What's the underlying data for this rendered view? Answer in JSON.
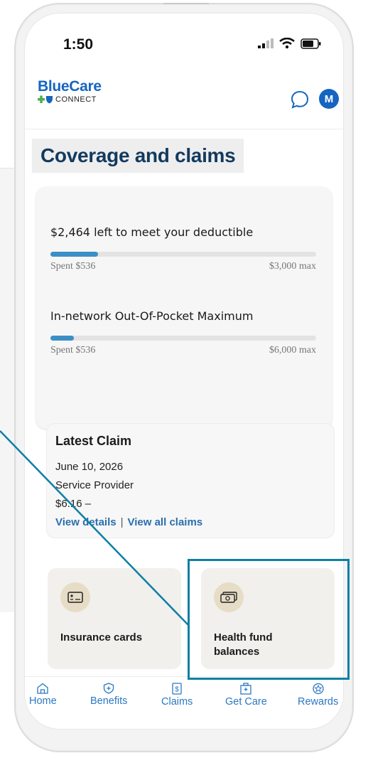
{
  "status_bar": {
    "time": "1:50"
  },
  "header": {
    "brand_name": "BlueCare",
    "brand_sub": "CONNECT",
    "avatar_initial": "M"
  },
  "page": {
    "title": "Coverage and claims"
  },
  "coverage": {
    "deductible": {
      "title": "$2,464 left to meet your deductible",
      "spent_label": "Spent $536",
      "max_label": "$3,000 max",
      "progress_fraction": 0.179
    },
    "oop": {
      "title": "In-network Out-Of-Pocket Maximum",
      "spent_label": "Spent $536",
      "max_label": "$6,000 max",
      "progress_fraction": 0.089
    }
  },
  "latest_claim": {
    "title": "Latest Claim",
    "date": "June 10, 2026",
    "provider": "Service Provider",
    "amount": "$6.16 –",
    "view_details": "View details",
    "separator": "|",
    "view_all": "View all claims"
  },
  "tiles": {
    "insurance": {
      "label": "Insurance cards"
    },
    "health_fund": {
      "label_line1": "Health fund",
      "label_line2": "balances"
    }
  },
  "nav": {
    "items": [
      {
        "label": "Home",
        "icon": "home-icon"
      },
      {
        "label": "Benefits",
        "icon": "benefits-icon"
      },
      {
        "label": "Claims",
        "icon": "claims-icon"
      },
      {
        "label": "Get Care",
        "icon": "get-care-icon"
      },
      {
        "label": "Rewards",
        "icon": "rewards-icon"
      }
    ]
  },
  "colors": {
    "brand_blue": "#1565c0",
    "link_blue": "#2a78c2",
    "progress_blue": "#3b8ec6",
    "callout_teal": "#0d7fa5",
    "title_navy": "#133a5e"
  }
}
